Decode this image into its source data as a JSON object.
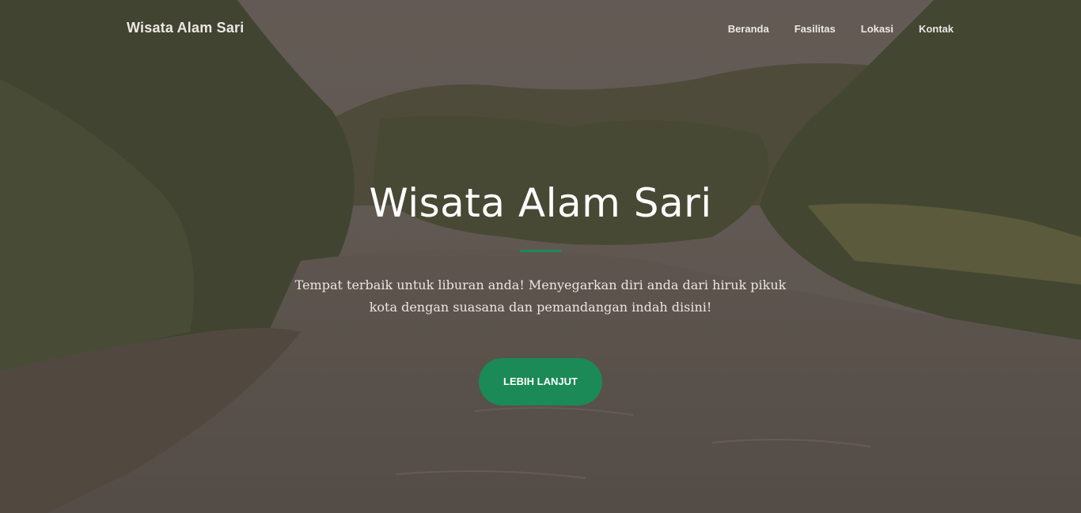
{
  "navbar": {
    "brand": "Wisata Alam Sari",
    "links": [
      {
        "label": "Beranda"
      },
      {
        "label": "Fasilitas"
      },
      {
        "label": "Lokasi"
      },
      {
        "label": "Kontak"
      }
    ]
  },
  "hero": {
    "title": "Wisata Alam Sari",
    "description": "Tempat terbaik untuk liburan anda! Menyegarkan diri anda dari hiruk pikuk kota dengan suasana dan pemandangan indah disini!",
    "cta_label": "LEBIH LANJUT"
  },
  "colors": {
    "accent": "#1b8a56",
    "overlay": "#463c37",
    "text": "#ffffff"
  }
}
